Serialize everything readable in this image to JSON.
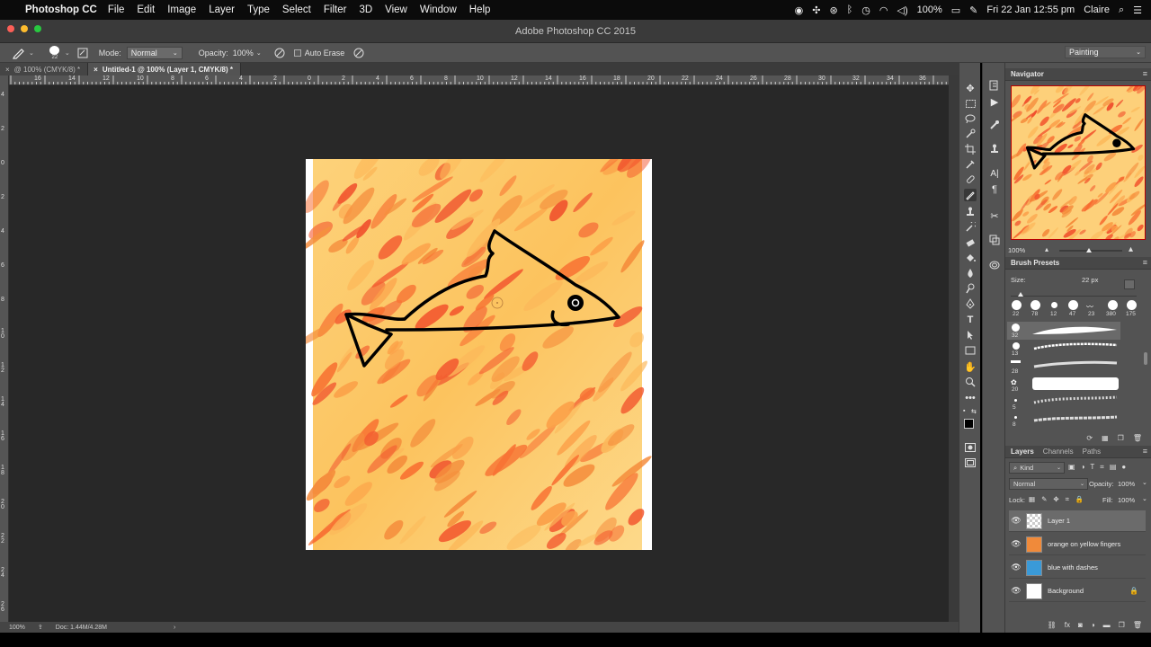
{
  "menubar": {
    "app_name": "Photoshop CC",
    "items": [
      "File",
      "Edit",
      "Image",
      "Layer",
      "Type",
      "Select",
      "Filter",
      "3D",
      "View",
      "Window",
      "Help"
    ],
    "battery": "100%",
    "datetime": "Fri 22 Jan  12:55 pm",
    "user": "Claire"
  },
  "window": {
    "title": "Adobe Photoshop CC 2015"
  },
  "options": {
    "brush_size": "22",
    "mode_label": "Mode:",
    "mode_value": "Normal",
    "opacity_label": "Opacity:",
    "opacity_value": "100%",
    "auto_erase": "Auto Erase",
    "workspace": "Painting"
  },
  "tabs": [
    {
      "label": "@ 100% (CMYK/8) *",
      "active": false
    },
    {
      "label": "Untitled-1 @ 100% (Layer 1, CMYK/8) *",
      "active": true
    }
  ],
  "rulers": {
    "h": [
      "16",
      "14",
      "12",
      "10",
      "8",
      "6",
      "4",
      "2",
      "0",
      "2",
      "4",
      "6",
      "8",
      "10",
      "12",
      "14",
      "16",
      "18",
      "20",
      "22",
      "24",
      "26",
      "28",
      "30",
      "32",
      "34",
      "36"
    ],
    "v": [
      "4",
      "2",
      "0",
      "2",
      "4",
      "6",
      "8",
      "1 0",
      "1 2",
      "1 4",
      "1 6",
      "1 8",
      "2 0",
      "2 2",
      "2 4",
      "2 6"
    ]
  },
  "status": {
    "zoom": "100%",
    "doc": "Doc: 1.44M/4.28M"
  },
  "navigator": {
    "title": "Navigator",
    "zoom": "100%"
  },
  "brush_presets": {
    "title": "Brush Presets",
    "size_label": "Size:",
    "size_value": "22 px",
    "top_sizes": [
      "22",
      "78",
      "12",
      "47",
      "23",
      "380",
      "175"
    ],
    "list_sizes": [
      "32",
      "13",
      "28",
      "20",
      "5",
      "8"
    ]
  },
  "layers_panel": {
    "tabs": [
      "Layers",
      "Channels",
      "Paths"
    ],
    "filter": "Kind",
    "blend": "Normal",
    "opacity_label": "Opacity:",
    "opacity_value": "100%",
    "lock_label": "Lock:",
    "fill_label": "Fill:",
    "fill_value": "100%",
    "layers": [
      {
        "name": "Layer 1",
        "selected": true,
        "thumb": "transparent"
      },
      {
        "name": "orange on yellow fingers",
        "selected": false,
        "thumb": "#f08a3a"
      },
      {
        "name": "blue with dashes",
        "selected": false,
        "thumb": "#3a9ad8"
      },
      {
        "name": "Background",
        "selected": false,
        "thumb": "#ffffff",
        "locked": true
      }
    ]
  }
}
